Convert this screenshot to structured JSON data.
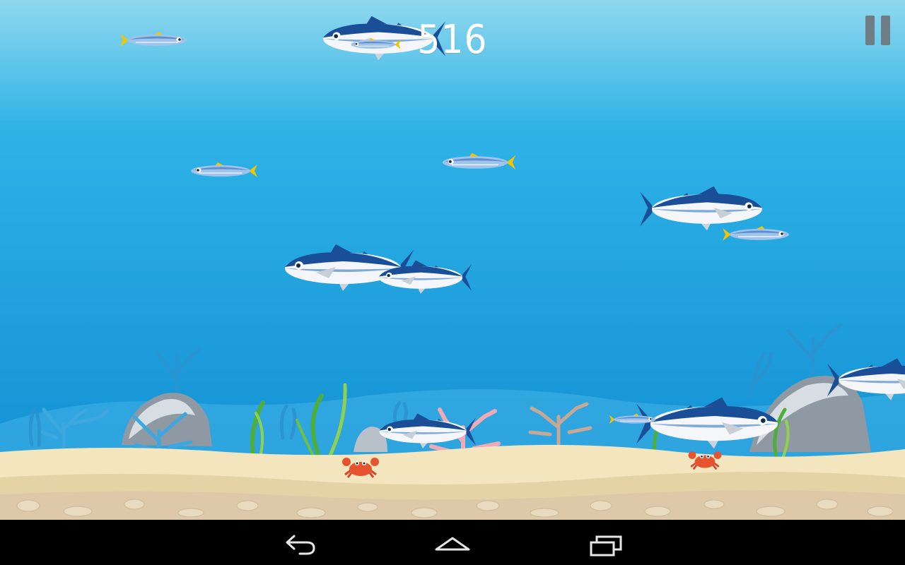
{
  "game": {
    "score": "516",
    "colors": {
      "water_top": "#8fd8ee",
      "water_bottom": "#0f8cd2",
      "sand": "#f3e6bf",
      "tuna_back": "#1a4f98",
      "tuna_belly": "#f4f6fa",
      "sardine_body": "#9fc3ea",
      "sardine_tail": "#f2c500"
    },
    "pause_icon": "pause-icon",
    "sprites": {
      "tuna": "tuna-fish-sprite",
      "sardine": "sardine-fish-sprite",
      "crab": "crab-sprite",
      "coral": "coral-sprite",
      "seaweed": "seaweed-sprite",
      "rock": "rock-sprite"
    }
  },
  "navbar": {
    "back_icon": "back-arrow-icon",
    "home_icon": "home-icon",
    "recents_icon": "recent-apps-icon"
  }
}
